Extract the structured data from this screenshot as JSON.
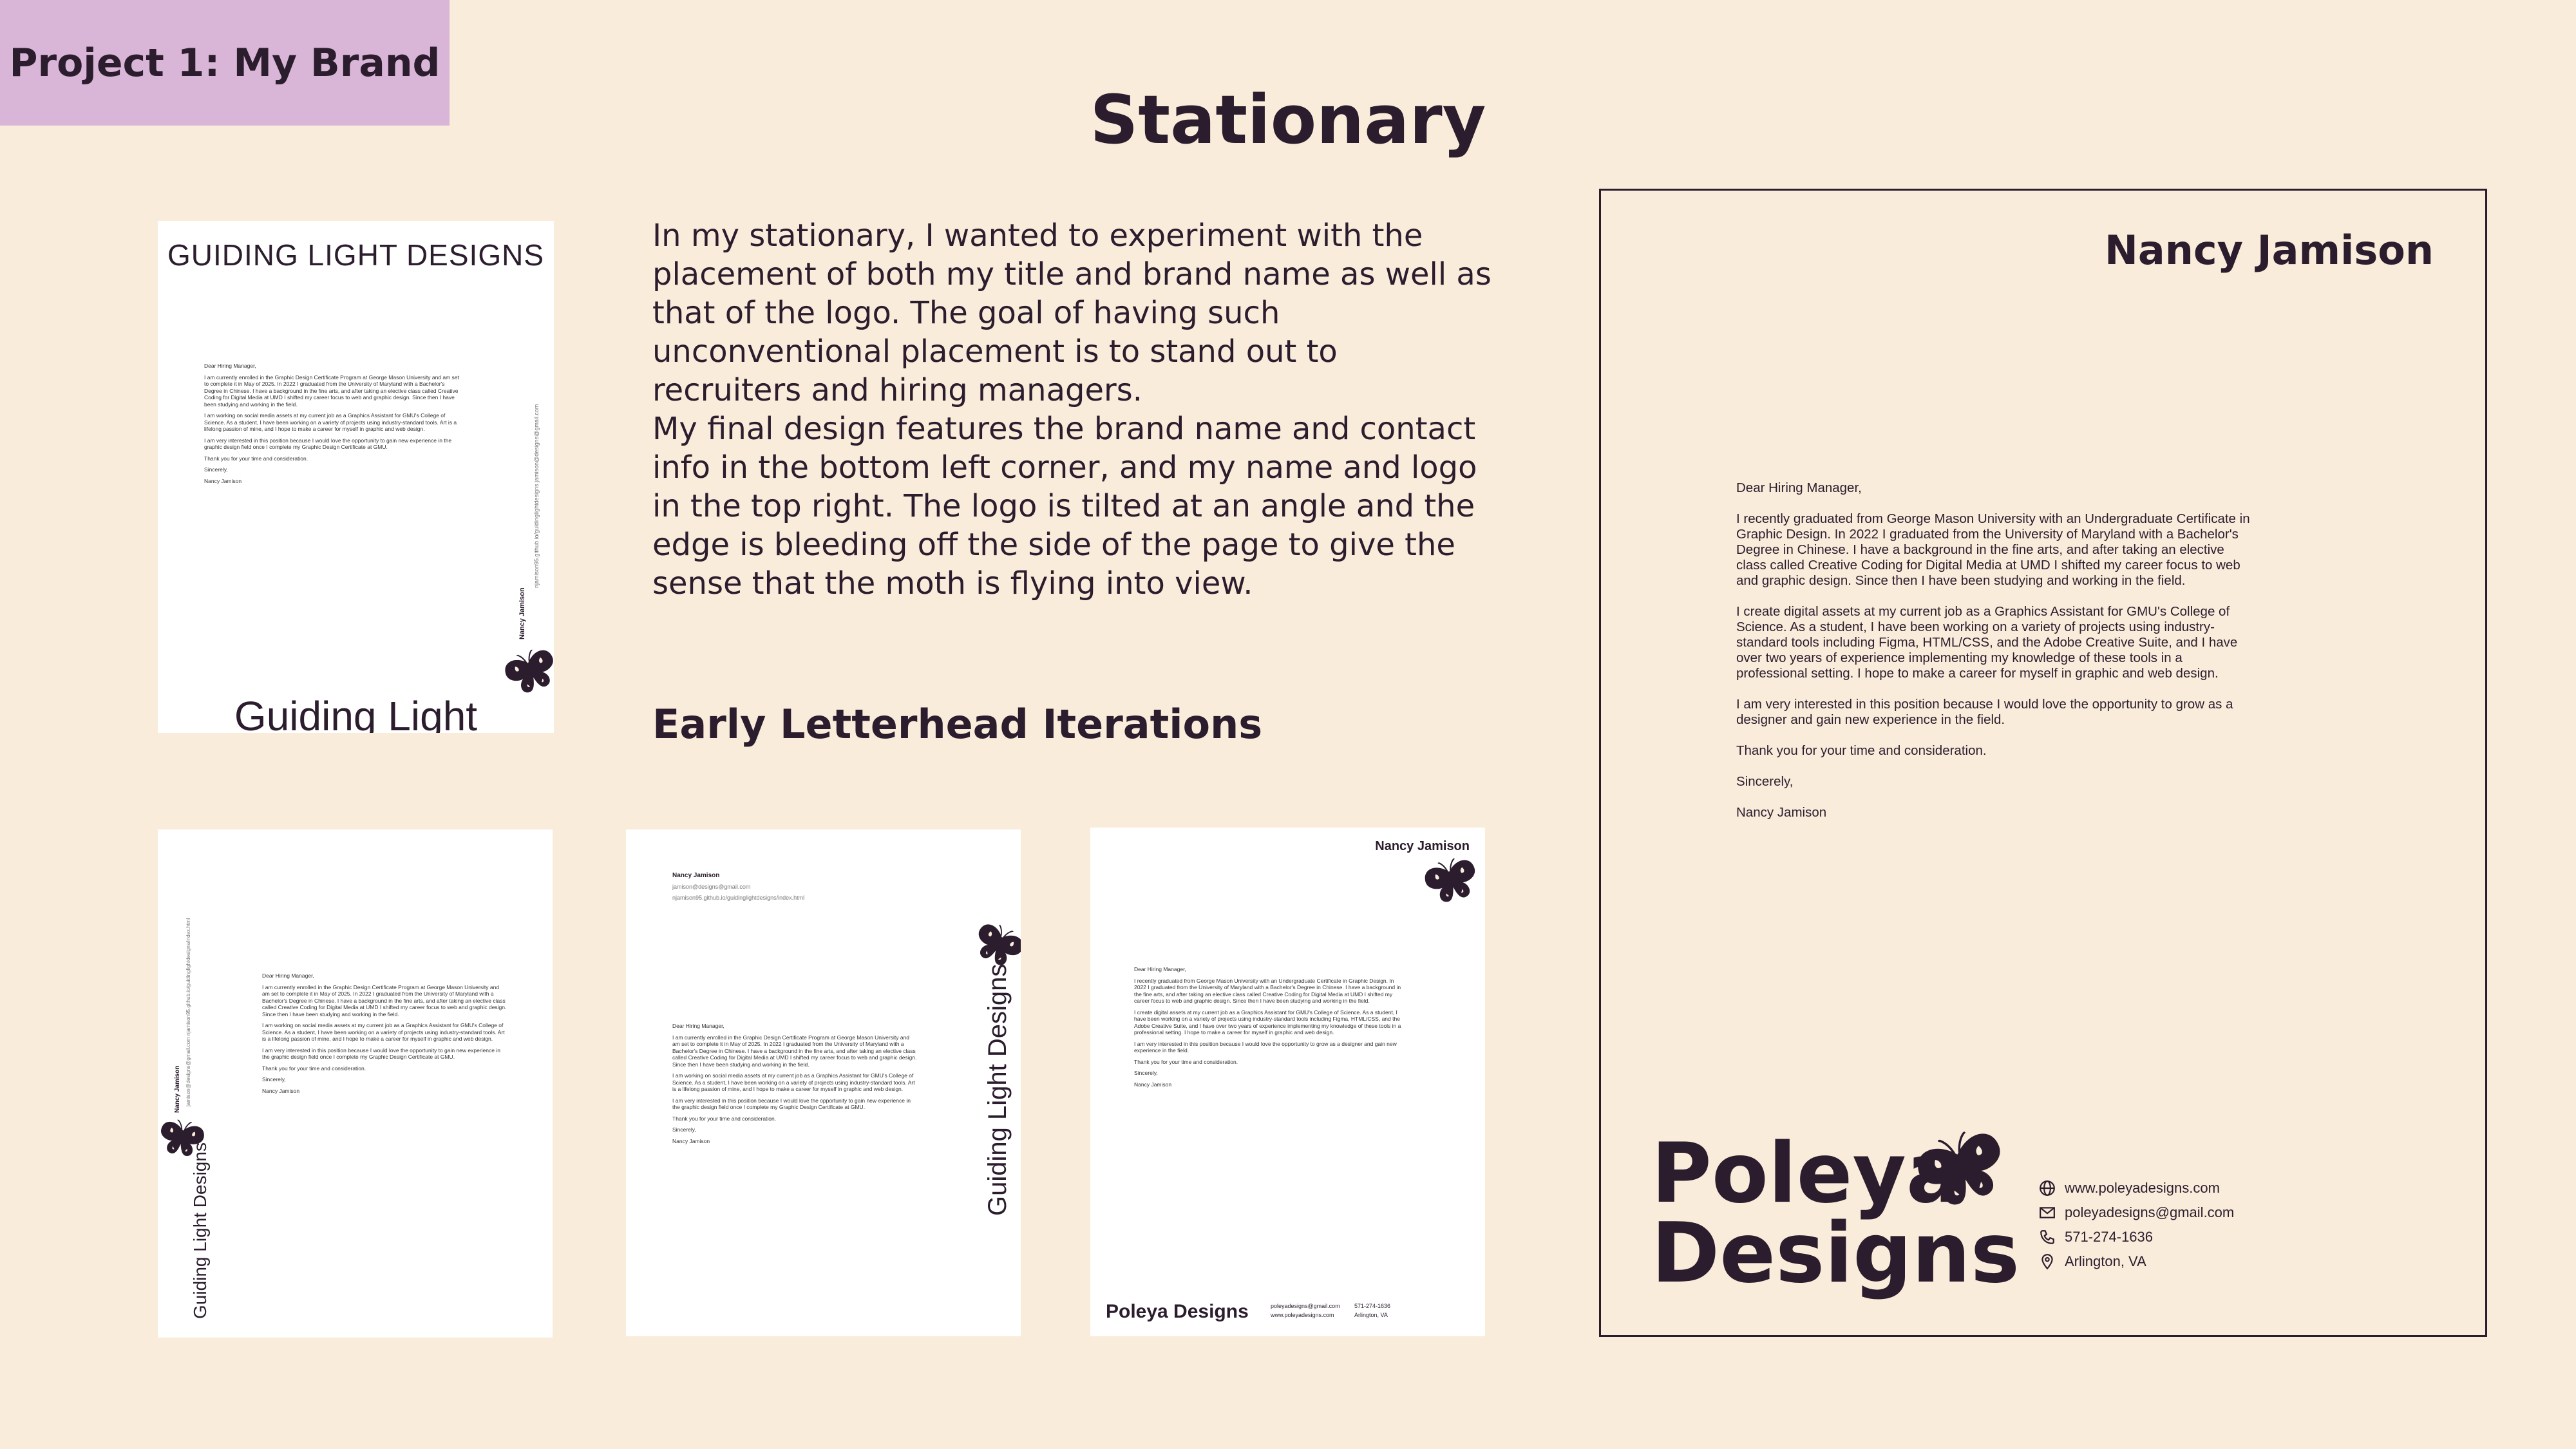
{
  "header": {
    "tag": "Project 1: My Brand",
    "title": "Stationary"
  },
  "description": {
    "paragraph_1": "In my stationary, I wanted to experiment with the placement of both my title and brand name as well as that of the logo. The goal of having such unconventional placement is to stand out to recruiters and hiring managers.",
    "paragraph_2": "My final design features the brand name and contact info in the bottom left corner, and my name and logo in the top right. The logo is tilted at an angle and the edge is bleeding off the side of the page to give the sense that the moth is flying into view.",
    "iterations_heading": "Early Letterhead Iterations"
  },
  "iteration_1": {
    "top_title": "GUIDING LIGHT DESIGNS",
    "bottom_title": "Guiding Light Designs",
    "side_name": "Nancy Jamison",
    "side_contact": "njamison95.github.io/guidinglightdesigns   jamison@designs@gmail.com",
    "letter": [
      "Dear Hiring Manager,",
      "I am currently enrolled in the Graphic Design Certificate Program at George Mason University and am set to complete it in May of 2025. In 2022 I graduated from the University of Maryland with a Bachelor's Degree in Chinese. I have a background in the fine arts, and after taking an elective class called Creative Coding for Digital Media at UMD I shifted my career focus to web and graphic design. Since then I have been studying and working in the field.",
      "I am working on social media assets at my current job as a Graphics Assistant for GMU's College of Science. As a student, I have been working on a variety of projects using industry-standard tools. Art is a lifelong passion of mine, and I hope to make a career for myself in graphic and web design.",
      "I am very interested in this position because I would love the opportunity to gain new experience in the graphic design field once I complete my Graphic Design Certificate at GMU.",
      "Thank you for your time and consideration.",
      "Sincerely,",
      "Nancy Jamison"
    ]
  },
  "iteration_2": {
    "side_title": "Guiding Light Designs",
    "side_name": "Nancy Jamison",
    "side_contact": "jamison@designs@gmail.com   njamison95.github.io/guidinglightdesigns/index.html"
  },
  "iteration_3": {
    "name": "Nancy Jamison",
    "email": "jamison@designs@gmail.com",
    "site": "njamison95.github.io/guidinglightdesigns/index.html",
    "side_title": "Guiding Light Designs"
  },
  "iteration_4": {
    "name": "Nancy Jamison",
    "brand": "Poleya Designs",
    "email": "poleyadesigns@gmail.com",
    "site": "www.poleyadesigns.com",
    "phone": "571-274-1636",
    "location": "Arlington, VA"
  },
  "final": {
    "name": "Nancy Jamison",
    "brand_line_1": "Poleya",
    "brand_line_2": "Designs",
    "website": "www.poleyadesigns.com",
    "email": "poleyadesigns@gmail.com",
    "phone": "571-274-1636",
    "location": "Arlington, VA",
    "letter": [
      "Dear Hiring Manager,",
      "I recently graduated from George Mason University with an Undergraduate Certificate in Graphic Design. In 2022 I graduated from the University of Maryland with a Bachelor's Degree in Chinese. I have a background in the fine arts, and after taking an elective class called Creative Coding for Digital Media at UMD I shifted my career focus to web and graphic design. Since then I have been studying and working in the field.",
      "I create digital assets at my current job as a Graphics Assistant for GMU's College of Science. As a student, I have been working on a variety of projects using industry-standard tools including Figma, HTML/CSS, and the Adobe Creative Suite, and I have over two years of experience implementing my knowledge of these tools in a professional setting. I hope to make a career for myself in graphic and web design.",
      "I am very interested in this position because I would love the opportunity to grow as a designer and gain new experience in the field.",
      "Thank you for your time and consideration.",
      "Sincerely,",
      "Nancy Jamison"
    ]
  }
}
